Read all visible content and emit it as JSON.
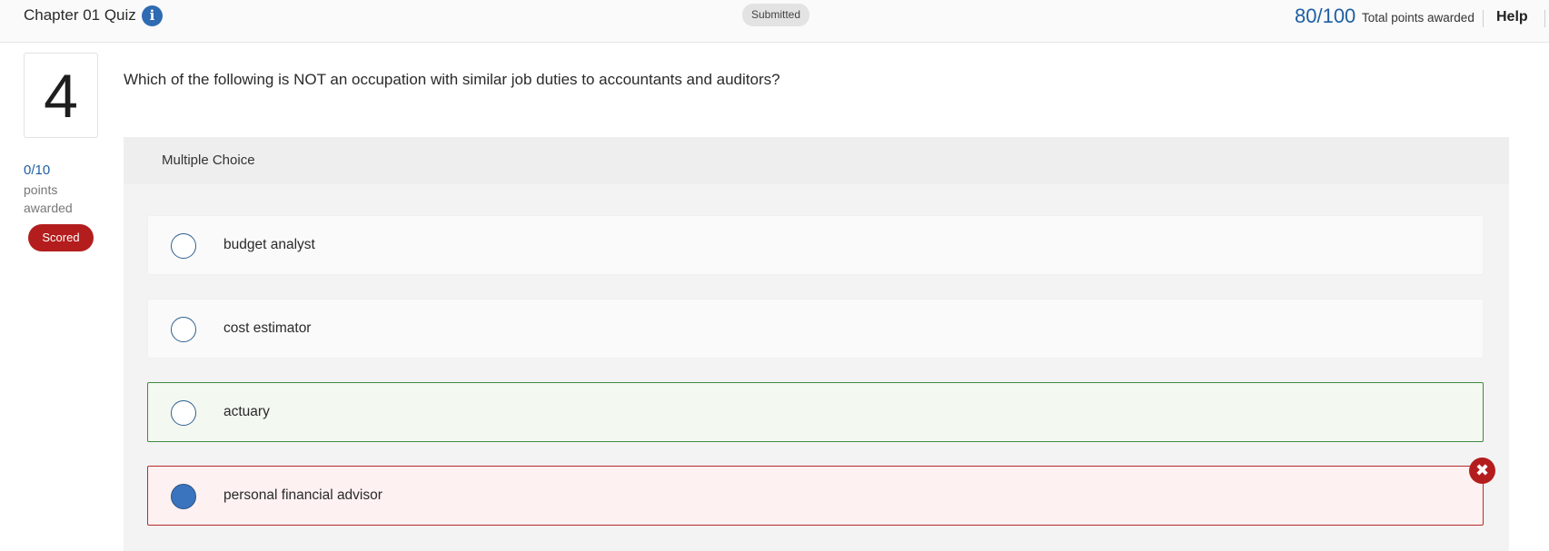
{
  "header": {
    "title": "Chapter 01 Quiz",
    "info_icon": "info-icon",
    "status": "Submitted",
    "total_score": "80/100",
    "total_label": "Total points awarded",
    "help_label": "Help"
  },
  "question": {
    "number": "4",
    "points": "0/10",
    "points_label": "points awarded",
    "badge": "Scored",
    "badge_color": "#b41d1d",
    "text": "Which of the following is NOT an occupation with similar job duties to accountants and auditors?",
    "type_label": "Multiple Choice",
    "options": [
      {
        "label": "budget analyst",
        "state": "default",
        "selected": false
      },
      {
        "label": "cost estimator",
        "state": "default",
        "selected": false
      },
      {
        "label": "actuary",
        "state": "correct",
        "selected": false
      },
      {
        "label": "personal financial advisor",
        "state": "incorrect",
        "selected": true
      }
    ],
    "incorrect_icon": "close-icon"
  },
  "colors": {
    "accent": "#1f5fa3",
    "correct": "#3f8a3f",
    "incorrect": "#b62b2b"
  }
}
